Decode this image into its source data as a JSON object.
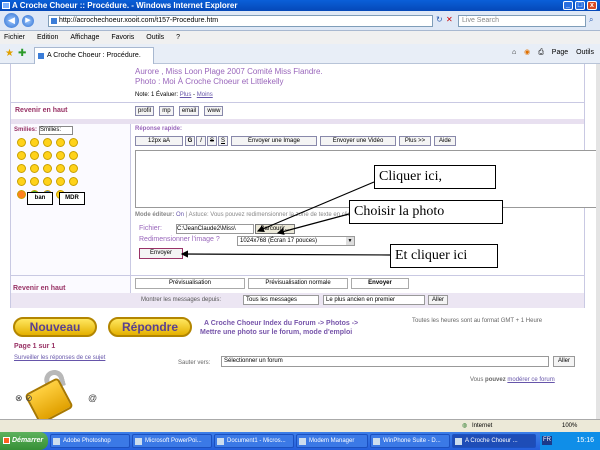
{
  "window": {
    "title": "A Croche Choeur :: Procédure. - Windows Internet Explorer",
    "min": "_",
    "max": "□",
    "close": "x"
  },
  "addressbar": {
    "url": "http://acrochechoeur.xooit.com/t157-Procedure.htm",
    "search_placeholder": "Live Search"
  },
  "menu": [
    "Fichier",
    "Edition",
    "Affichage",
    "Favoris",
    "Outils",
    "?"
  ],
  "tab": {
    "title": "A Croche Choeur : Procédure."
  },
  "tools": {
    "page": "Page",
    "outils": "Outils"
  },
  "post": {
    "line1": "Aurore , Miss Loon Plage 2007 Comité Miss Flandre.",
    "line2": "Photo : Moi À Croche Choeur et Littlekelly",
    "note_label": "Note: 1",
    "evaluer_label": "Évaluer:",
    "plus": "Plus",
    "moins": "Moins",
    "sep": " - "
  },
  "nav": {
    "back_top": "Revenir en haut",
    "profile": "profil",
    "mp": "mp",
    "email": "email",
    "www": "www"
  },
  "smilies": {
    "label": "Smilies:",
    "select": "Smilies:",
    "badge1": "ban",
    "badge2": "MDR"
  },
  "quick_reply": {
    "title": "Réponse rapide:",
    "font_size": "12px",
    "font_a": "aA",
    "bold": "G",
    "italic": "I",
    "strike": "S",
    "underline": "S",
    "send_image": "Envoyer une Image",
    "send_video": "Envoyer une Vidéo",
    "plus": "Plus >>",
    "help": "Aide"
  },
  "editor_mode": {
    "label": "Mode éditeur:",
    "on": "On",
    "separator": "|",
    "astuce": "Astuce: Vous pouvez redimensionner la zone de texte en cliquant et glissant ce point en bas à droite."
  },
  "upload": {
    "file_label": "Fichier:",
    "file_value": "C:\\JeanClaude2\\Miss\\",
    "browse": "Parcourir...",
    "resize_label": "Redimensionner l'image ?",
    "resize_value": "1024x768 (Écran 17 pouces)",
    "send": "Envoyer"
  },
  "callouts": {
    "c1": "Cliquer ici,",
    "c2": "Choisir la photo",
    "c3": "Et cliquer ici"
  },
  "actions": {
    "preview": "Prévisualisation",
    "preview_normal": "Prévisualisation normale",
    "send": "Envoyer"
  },
  "filter": {
    "label": "Montrer les messages depuis:",
    "period": "Tous les messages",
    "order": "Le plus ancien en premier",
    "go": "Aller"
  },
  "bottom": {
    "new_btn": "Nouveau",
    "reply_btn": "Répondre",
    "breadcrumb": "A Croche Choeur Index du Forum -> Photos ->",
    "topic_title": "Mettre une photo sur le forum, mode d'emploi",
    "timezone": "Toutes les heures sont au format GMT + 1 Heure",
    "page_info": "Page 1 sur 1",
    "watch": "Surveiller les réponses de ce sujet",
    "jump_label": "Sauter vers:",
    "jump_select": "Sélectionner un forum",
    "jump_go": "Aller",
    "moderate_prefix": "Vous",
    "moderate_can": "pouvez",
    "moderate_link": "modérer ce forum"
  },
  "statusbar": {
    "zone": "Internet",
    "zoom": "100%"
  },
  "taskbar": {
    "start": "Démarrer",
    "tasks": [
      "Adobe Photoshop",
      "Microsoft PowerPoi...",
      "Document1 - Micros...",
      "Modem Manager",
      "WinPhone Suite - D...",
      "A Croche Choeur ..."
    ],
    "clock": "15:16",
    "lang": "FR"
  },
  "colors": {
    "accent": "#9966bb",
    "link": "#6655aa",
    "section": "#993366",
    "ie_blue": "#0548b8"
  }
}
